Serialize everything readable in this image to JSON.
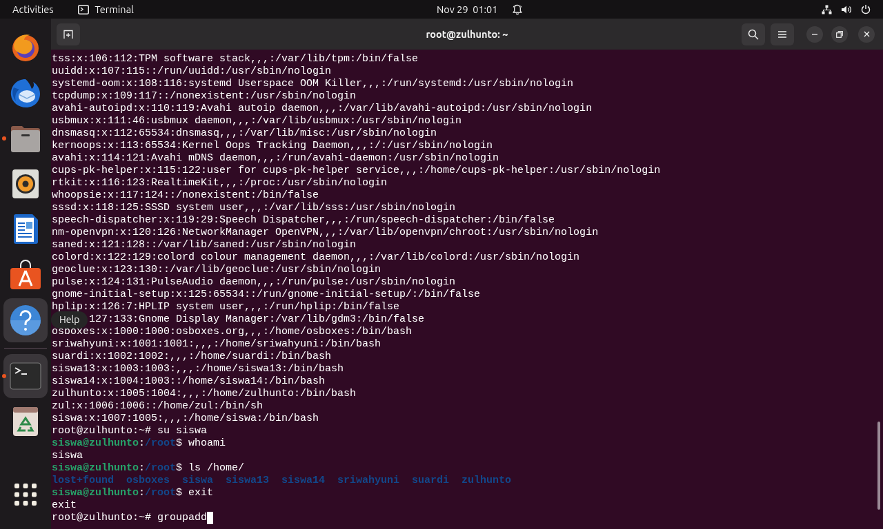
{
  "top_bar": {
    "activities": "Activities",
    "app_name": "Terminal",
    "date": "Nov 29",
    "time": "01:01"
  },
  "dock": {
    "apps": [
      {
        "kind": "firefox",
        "running": false,
        "highlighted": false
      },
      {
        "kind": "thunderbird",
        "running": false,
        "highlighted": false
      },
      {
        "kind": "files",
        "running": true,
        "highlighted": false
      },
      {
        "kind": "rhythmbox",
        "running": false,
        "highlighted": false
      },
      {
        "kind": "writer",
        "running": false,
        "highlighted": false
      },
      {
        "kind": "appcenter",
        "running": false,
        "highlighted": false
      },
      {
        "kind": "help",
        "running": false,
        "highlighted": true
      },
      {
        "kind": "separator"
      },
      {
        "kind": "terminal",
        "running": true,
        "highlighted": true
      },
      {
        "kind": "trash",
        "running": false,
        "highlighted": false
      },
      {
        "kind": "grid",
        "running": false,
        "highlighted": false
      }
    ],
    "tooltip": "Help"
  },
  "window": {
    "title": "root@zulhunto: ~"
  },
  "terminal": {
    "cursor": true,
    "lines": [
      [
        {
          "kind": "plain",
          "text": "tss:x:106:112:TPM software stack,,,:/var/lib/tpm:/bin/false"
        }
      ],
      [
        {
          "kind": "plain",
          "text": "uuidd:x:107:115::/run/uuidd:/usr/sbin/nologin"
        }
      ],
      [
        {
          "kind": "plain",
          "text": "systemd-oom:x:108:116:systemd Userspace OOM Killer,,,:/run/systemd:/usr/sbin/nologin"
        }
      ],
      [
        {
          "kind": "plain",
          "text": "tcpdump:x:109:117::/nonexistent:/usr/sbin/nologin"
        }
      ],
      [
        {
          "kind": "plain",
          "text": "avahi-autoipd:x:110:119:Avahi autoip daemon,,,:/var/lib/avahi-autoipd:/usr/sbin/nologin"
        }
      ],
      [
        {
          "kind": "plain",
          "text": "usbmux:x:111:46:usbmux daemon,,,:/var/lib/usbmux:/usr/sbin/nologin"
        }
      ],
      [
        {
          "kind": "plain",
          "text": "dnsmasq:x:112:65534:dnsmasq,,,:/var/lib/misc:/usr/sbin/nologin"
        }
      ],
      [
        {
          "kind": "plain",
          "text": "kernoops:x:113:65534:Kernel Oops Tracking Daemon,,,:/:/usr/sbin/nologin"
        }
      ],
      [
        {
          "kind": "plain",
          "text": "avahi:x:114:121:Avahi mDNS daemon,,,:/run/avahi-daemon:/usr/sbin/nologin"
        }
      ],
      [
        {
          "kind": "plain",
          "text": "cups-pk-helper:x:115:122:user for cups-pk-helper service,,,:/home/cups-pk-helper:/usr/sbin/nologin"
        }
      ],
      [
        {
          "kind": "plain",
          "text": "rtkit:x:116:123:RealtimeKit,,,:/proc:/usr/sbin/nologin"
        }
      ],
      [
        {
          "kind": "plain",
          "text": "whoopsie:x:117:124::/nonexistent:/bin/false"
        }
      ],
      [
        {
          "kind": "plain",
          "text": "sssd:x:118:125:SSSD system user,,,:/var/lib/sss:/usr/sbin/nologin"
        }
      ],
      [
        {
          "kind": "plain",
          "text": "speech-dispatcher:x:119:29:Speech Dispatcher,,,:/run/speech-dispatcher:/bin/false"
        }
      ],
      [
        {
          "kind": "plain",
          "text": "nm-openvpn:x:120:126:NetworkManager OpenVPN,,,:/var/lib/openvpn/chroot:/usr/sbin/nologin"
        }
      ],
      [
        {
          "kind": "plain",
          "text": "saned:x:121:128::/var/lib/saned:/usr/sbin/nologin"
        }
      ],
      [
        {
          "kind": "plain",
          "text": "colord:x:122:129:colord colour management daemon,,,:/var/lib/colord:/usr/sbin/nologin"
        }
      ],
      [
        {
          "kind": "plain",
          "text": "geoclue:x:123:130::/var/lib/geoclue:/usr/sbin/nologin"
        }
      ],
      [
        {
          "kind": "plain",
          "text": "pulse:x:124:131:PulseAudio daemon,,,:/run/pulse:/usr/sbin/nologin"
        }
      ],
      [
        {
          "kind": "plain",
          "text": "gnome-initial-setup:x:125:65534::/run/gnome-initial-setup/:/bin/false"
        }
      ],
      [
        {
          "kind": "plain",
          "text": "hplip:x:126:7:HPLIP system user,,,:/run/hplip:/bin/false"
        }
      ],
      [
        {
          "kind": "covered"
        },
        {
          "kind": "plain",
          "text": "127:133:Gnome Display Manager:/var/lib/gdm3:/bin/false"
        }
      ],
      [
        {
          "kind": "plain",
          "text": "osboxes:x:1000:1000:osboxes.org,,,:/home/osboxes:/bin/bash"
        }
      ],
      [
        {
          "kind": "plain",
          "text": "sriwahyuni:x:1001:1001:,,,:/home/sriwahyuni:/bin/bash"
        }
      ],
      [
        {
          "kind": "plain",
          "text": "suardi:x:1002:1002:,,,:/home/suardi:/bin/bash"
        }
      ],
      [
        {
          "kind": "plain",
          "text": "siswa13:x:1003:1003:,,,:/home/siswa13:/bin/bash"
        }
      ],
      [
        {
          "kind": "plain",
          "text": "siswa14:x:1004:1003::/home/siswa14:/bin/bash"
        }
      ],
      [
        {
          "kind": "plain",
          "text": "zulhunto:x:1005:1004:,,,:/home/zulhunto:/bin/bash"
        }
      ],
      [
        {
          "kind": "plain",
          "text": "zul:x:1006:1006::/home/zul:/bin/sh"
        }
      ],
      [
        {
          "kind": "plain",
          "text": "siswa:x:1007:1005:,,,:/home/siswa:/bin/bash"
        }
      ],
      [
        {
          "kind": "plain",
          "text": "root@zulhunto:~# su siswa"
        }
      ],
      [
        {
          "kind": "user",
          "text": "siswa@zulhunto"
        },
        {
          "kind": "plain",
          "text": ":"
        },
        {
          "kind": "path",
          "text": "/root"
        },
        {
          "kind": "plain",
          "text": "$ whoami"
        }
      ],
      [
        {
          "kind": "plain",
          "text": "siswa"
        }
      ],
      [
        {
          "kind": "user",
          "text": "siswa@zulhunto"
        },
        {
          "kind": "plain",
          "text": ":"
        },
        {
          "kind": "path",
          "text": "/root"
        },
        {
          "kind": "plain",
          "text": "$ ls /home/"
        }
      ],
      [
        {
          "kind": "dir",
          "text": "lost+found"
        },
        {
          "kind": "dir",
          "text": "osboxes"
        },
        {
          "kind": "dir",
          "text": "siswa"
        },
        {
          "kind": "dir",
          "text": "siswa13"
        },
        {
          "kind": "dir",
          "text": "siswa14"
        },
        {
          "kind": "dir",
          "text": "sriwahyuni"
        },
        {
          "kind": "dir",
          "text": "suardi"
        },
        {
          "kind": "dir",
          "text": "zulhunto"
        }
      ],
      [
        {
          "kind": "user",
          "text": "siswa@zulhunto"
        },
        {
          "kind": "plain",
          "text": ":"
        },
        {
          "kind": "path",
          "text": "/root"
        },
        {
          "kind": "plain",
          "text": "$ exit"
        }
      ],
      [
        {
          "kind": "plain",
          "text": "exit"
        }
      ],
      [
        {
          "kind": "plain",
          "text": "root@zulhunto:~# groupadd"
        }
      ]
    ]
  }
}
